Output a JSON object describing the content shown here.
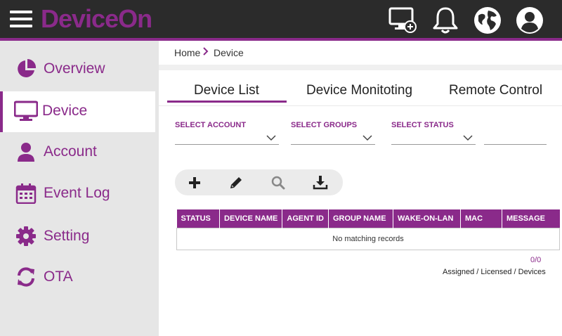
{
  "app": {
    "brand": "DeviceOn"
  },
  "header": {
    "icons": [
      "add-device-icon",
      "bell-icon",
      "globe-icon",
      "user-avatar-icon"
    ]
  },
  "sidebar": {
    "items": [
      {
        "label": "Overview",
        "icon": "pie-chart-icon",
        "active": false
      },
      {
        "label": "Device",
        "icon": "monitor-icon",
        "active": true
      },
      {
        "label": "Account",
        "icon": "user-icon",
        "active": false
      },
      {
        "label": "Event Log",
        "icon": "calendar-icon",
        "active": false
      },
      {
        "label": "Setting",
        "icon": "gear-icon",
        "active": false
      },
      {
        "label": "OTA",
        "icon": "refresh-icon",
        "active": false
      }
    ]
  },
  "breadcrumb": {
    "home": "Home",
    "current": "Device"
  },
  "tabs": [
    {
      "label": "Device List",
      "active": true
    },
    {
      "label": "Device Monitoting",
      "active": false
    },
    {
      "label": "Remote Control",
      "active": false
    }
  ],
  "filters": {
    "account_label": "SELECT ACCOUNT",
    "account_value": "",
    "groups_label": "SELECT GROUPS",
    "groups_value": "",
    "status_label": "SELECT STATUS",
    "status_value": "",
    "search_value": ""
  },
  "toolbar": {
    "buttons": [
      "add-icon",
      "edit-icon",
      "search-icon",
      "download-icon"
    ]
  },
  "table": {
    "columns": [
      "STATUS",
      "DEVICE NAME",
      "AGENT ID",
      "GROUP NAME",
      "WAKE-ON-LAN",
      "MAC",
      "MESSAGE"
    ],
    "empty_message": "No matching records"
  },
  "summary": {
    "count": "0/0",
    "label": "Assigned / Licensed / Devices"
  },
  "colors": {
    "accent": "#8a2a8a",
    "topbar": "#2b2b2b",
    "sidebar": "#e6e6e6"
  }
}
